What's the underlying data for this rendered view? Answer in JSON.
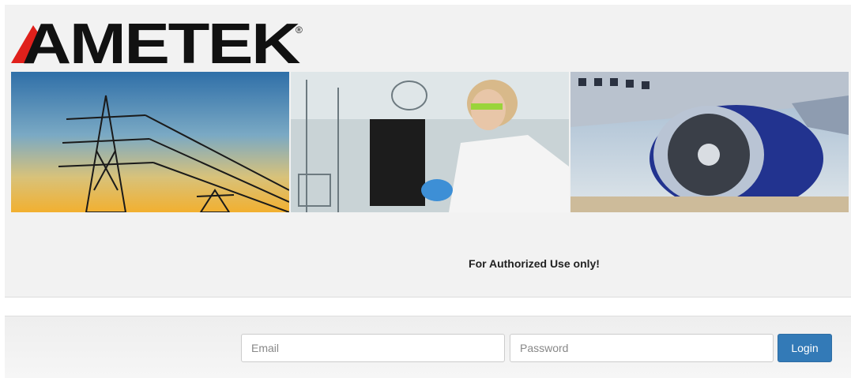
{
  "brand": {
    "logo_text": "AMETEK",
    "registered_mark": "®",
    "logo_red": "#e0201b",
    "logo_black": "#111111"
  },
  "banner": {
    "panels": [
      {
        "subject": "power-transmission-towers"
      },
      {
        "subject": "lab-scientist"
      },
      {
        "subject": "jet-engine"
      }
    ]
  },
  "notice": {
    "text": "For Authorized Use only!"
  },
  "login": {
    "email_placeholder": "Email",
    "password_placeholder": "Password",
    "button_label": "Login",
    "button_color": "#337ab7"
  }
}
